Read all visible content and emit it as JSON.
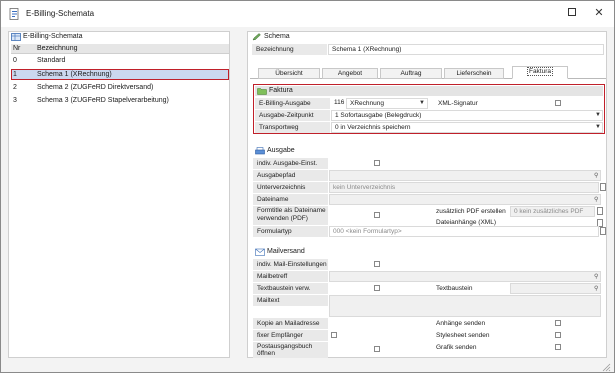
{
  "window": {
    "title": "E-Billing-Schemata",
    "maximize_icon": "maximize-icon",
    "close_icon": "close-icon",
    "close_glyph": "✕"
  },
  "left": {
    "title": "E-Billing-Schemata",
    "columns": {
      "nr": "Nr",
      "bezeichnung": "Bezeichnung"
    },
    "rows": [
      {
        "nr": "0",
        "name": "Standard"
      },
      {
        "nr": "1",
        "name": "Schema 1 (XRechnung)"
      },
      {
        "nr": "2",
        "name": "Schema 2 (ZUGFeRD Direktversand)"
      },
      {
        "nr": "3",
        "name": "Schema 3 (ZUGFeRD Stapelverarbeitung)"
      }
    ],
    "selected_index": 1
  },
  "schema": {
    "title": "Schema",
    "bezeichnung_label": "Bezeichnung",
    "bezeichnung_value": "Schema 1 (XRechnung)"
  },
  "tabs": [
    "Übersicht",
    "Angebot",
    "Auftrag",
    "Lieferschein",
    "Faktura"
  ],
  "active_tab": "Faktura",
  "faktura": {
    "title": "Faktura",
    "ebilling_label": "E-Billing-Ausgabe",
    "ebilling_nr": "116",
    "ebilling_value": "XRechnung",
    "xml_signatur_label": "XML-Signatur",
    "zeitpunkt_label": "Ausgabe-Zeitpunkt",
    "zeitpunkt_value": "1 Sofortausgabe (Belegdruck)",
    "transportweg_label": "Transportweg",
    "transportweg_value": "0 in Verzeichnis speichern"
  },
  "ausgabe": {
    "title": "Ausgabe",
    "indiv_label": "indiv. Ausgabe-Einst.",
    "ausgabepfad_label": "Ausgabepfad",
    "unterverzeichnis_label": "Unterverzeichnis",
    "unterverzeichnis_value": "kein Unterverzeichnis",
    "dateiname_label": "Dateiname",
    "formtitle_label": "Formtitle als Dateiname verwenden (PDF)",
    "zusaetzlich_label": "zusätzlich PDF erstellen",
    "zusaetzlich_value": "0 kein zusätzliches PDF",
    "dateianhaenge_label": "Dateianhänge (XML)",
    "formulartyp_label": "Formulartyp",
    "formulartyp_value": "000 <kein Formulartyp>"
  },
  "mailversand": {
    "title": "Mailversand",
    "indiv_label": "indiv. Mail-Einstellungen",
    "mailbetreff_label": "Mailbetreff",
    "textbaustein_verw_label": "Textbaustein verw.",
    "textbaustein_label": "Textbaustein",
    "mailtext_label": "Mailtext",
    "kopie_label": "Kopie an Mailadresse",
    "anhaenge_label": "Anhänge senden",
    "fixer_label": "fixer Empfänger",
    "stylesheet_label": "Stylesheet senden",
    "postausgang_label": "Postausgangsbuch öffnen",
    "grafik_label": "Grafik senden"
  },
  "colors": {
    "selection": "#cbd8ef",
    "highlight_border": "#c0202a",
    "label_bg": "#e9e9e9"
  }
}
